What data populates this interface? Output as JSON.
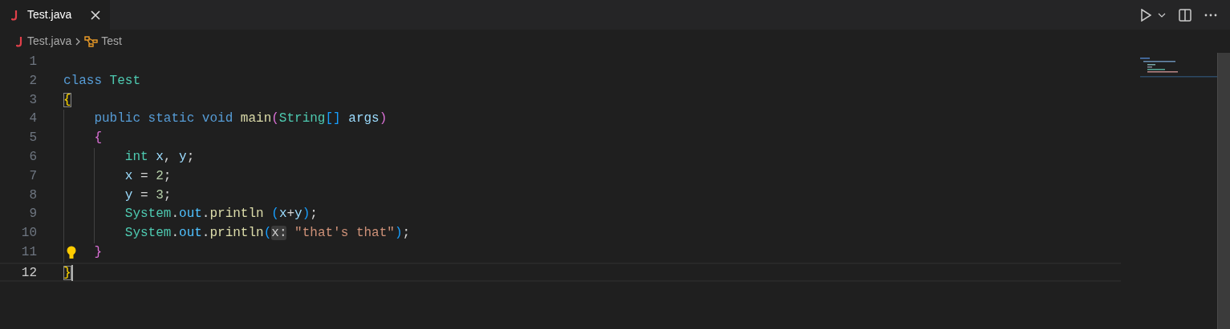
{
  "tabs": [
    {
      "label": "Test.java",
      "selected": true
    }
  ],
  "breadcrumbs": [
    {
      "label": "Test.java",
      "kind": "file"
    },
    {
      "label": "Test",
      "kind": "class"
    }
  ],
  "editor": {
    "lines": [
      {
        "number": "1",
        "current": false,
        "lightbulb": false
      },
      {
        "number": "2",
        "current": false,
        "lightbulb": false,
        "tokens": [
          {
            "text": "class",
            "kind": "keyword"
          },
          {
            "text": " Test",
            "kind": "type"
          }
        ]
      },
      {
        "number": "3",
        "current": false,
        "lightbulb": false,
        "tokens": [
          {
            "text": "{",
            "kind": "brace_matched"
          }
        ]
      },
      {
        "number": "4",
        "current": false,
        "lightbulb": false,
        "tokens": [
          {
            "text": "    public static void",
            "kind": "keyword"
          },
          {
            "text": " main",
            "kind": "func"
          },
          {
            "text": "(",
            "kind": "bracket2"
          },
          {
            "text": "String",
            "kind": "type"
          },
          {
            "text": "[]",
            "kind": "bracket3"
          },
          {
            "text": " args",
            "kind": "var"
          },
          {
            "text": ")",
            "kind": "bracket2"
          }
        ]
      },
      {
        "number": "5",
        "current": false,
        "lightbulb": false,
        "tokens": [
          {
            "text": "    {",
            "kind": "bracket2"
          }
        ]
      },
      {
        "number": "6",
        "current": false,
        "lightbulb": false,
        "tokens": [
          {
            "text": "        int",
            "kind": "keyword_type"
          },
          {
            "text": " x",
            "kind": "var"
          },
          {
            "text": ",",
            "kind": "plain"
          },
          {
            "text": " y",
            "kind": "var"
          },
          {
            "text": ";",
            "kind": "plain"
          }
        ]
      },
      {
        "number": "7",
        "current": false,
        "lightbulb": false,
        "tokens": [
          {
            "text": "        x",
            "kind": "var"
          },
          {
            "text": " = ",
            "kind": "plain"
          },
          {
            "text": "2",
            "kind": "number"
          },
          {
            "text": ";",
            "kind": "plain"
          }
        ]
      },
      {
        "number": "8",
        "current": false,
        "lightbulb": false,
        "tokens": [
          {
            "text": "        y",
            "kind": "var"
          },
          {
            "text": " = ",
            "kind": "plain"
          },
          {
            "text": "3",
            "kind": "number"
          },
          {
            "text": ";",
            "kind": "plain"
          }
        ]
      },
      {
        "number": "9",
        "current": false,
        "lightbulb": false,
        "tokens": [
          {
            "text": "        System",
            "kind": "type"
          },
          {
            "text": ".",
            "kind": "plain"
          },
          {
            "text": "out",
            "kind": "field"
          },
          {
            "text": ".",
            "kind": "plain"
          },
          {
            "text": "println",
            "kind": "func"
          },
          {
            "text": " (",
            "kind": "bracket3"
          },
          {
            "text": "x",
            "kind": "var"
          },
          {
            "text": "+",
            "kind": "plain"
          },
          {
            "text": "y",
            "kind": "var"
          },
          {
            "text": ")",
            "kind": "bracket3"
          },
          {
            "text": ";",
            "kind": "plain"
          }
        ]
      },
      {
        "number": "10",
        "current": false,
        "lightbulb": false,
        "tokens": [
          {
            "text": "        System",
            "kind": "type"
          },
          {
            "text": ".",
            "kind": "plain"
          },
          {
            "text": "out",
            "kind": "field"
          },
          {
            "text": ".",
            "kind": "plain"
          },
          {
            "text": "println",
            "kind": "func"
          },
          {
            "text": "(",
            "kind": "bracket3"
          },
          {
            "text": "x:",
            "kind": "hint"
          },
          {
            "text": " \"that's that\"",
            "kind": "string"
          },
          {
            "text": ")",
            "kind": "bracket3"
          },
          {
            "text": ";",
            "kind": "plain"
          }
        ]
      },
      {
        "number": "11",
        "current": false,
        "lightbulb": true,
        "tokens": [
          {
            "text": "    }",
            "kind": "bracket2"
          }
        ]
      },
      {
        "number": "12",
        "current": true,
        "lightbulb": false,
        "tokens": [
          {
            "text": "}",
            "kind": "brace_matched"
          }
        ]
      }
    ]
  }
}
